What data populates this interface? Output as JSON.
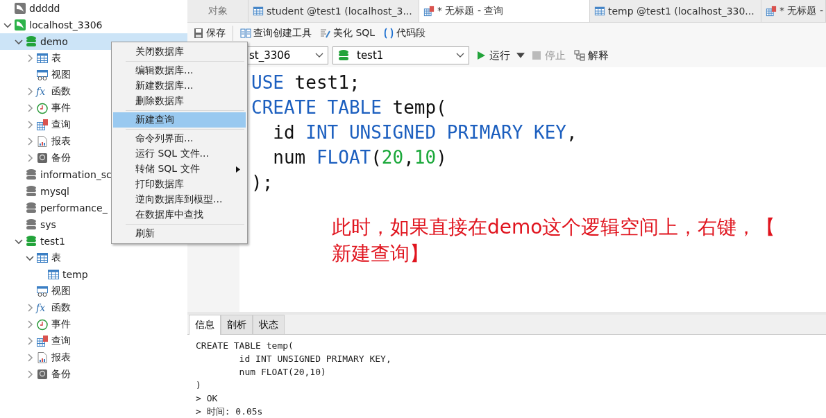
{
  "tree": [
    {
      "label": "ddddd",
      "kind": "server-gray",
      "selected": false
    },
    {
      "label": "localhost_3306",
      "kind": "server",
      "selected": false,
      "expanded": true,
      "children": [
        {
          "label": "demo",
          "kind": "db-green",
          "selected": true,
          "expanded": true,
          "children": [
            {
              "label": "表",
              "kind": "table",
              "selected": false,
              "expanded": false
            },
            {
              "label": "视图",
              "kind": "view",
              "selected": false
            },
            {
              "label": "函数",
              "kind": "function",
              "glyph": "fx",
              "selected": false,
              "expanded": false
            },
            {
              "label": "事件",
              "kind": "event",
              "selected": false,
              "expanded": false
            },
            {
              "label": "查询",
              "kind": "query",
              "selected": false,
              "expanded": false
            },
            {
              "label": "报表",
              "kind": "report",
              "selected": false,
              "expanded": false
            },
            {
              "label": "备份",
              "kind": "backup",
              "selected": false,
              "expanded": false
            }
          ]
        },
        {
          "label": "information_sc",
          "kind": "db-gray",
          "selected": false
        },
        {
          "label": "mysql",
          "kind": "db-gray",
          "selected": false
        },
        {
          "label": "performance_",
          "kind": "db-gray",
          "selected": false
        },
        {
          "label": "sys",
          "kind": "db-gray",
          "selected": false
        },
        {
          "label": "test1",
          "kind": "db-green",
          "selected": false,
          "expanded": true,
          "children": [
            {
              "label": "表",
              "kind": "table",
              "selected": false,
              "expanded": true,
              "children": [
                {
                  "label": "temp",
                  "kind": "table",
                  "selected": false
                }
              ]
            },
            {
              "label": "视图",
              "kind": "view",
              "selected": false
            },
            {
              "label": "函数",
              "kind": "function",
              "glyph": "fx",
              "selected": false,
              "expanded": false
            },
            {
              "label": "事件",
              "kind": "event",
              "selected": false,
              "expanded": false
            },
            {
              "label": "查询",
              "kind": "query",
              "selected": false,
              "expanded": false
            },
            {
              "label": "报表",
              "kind": "report",
              "selected": false,
              "expanded": false
            },
            {
              "label": "备份",
              "kind": "backup",
              "selected": false,
              "expanded": false
            }
          ]
        }
      ]
    }
  ],
  "tabs": [
    {
      "label": "对象",
      "selected": false
    },
    {
      "label": "student @test1 (localhost_3...",
      "kind": "table",
      "selected": false
    },
    {
      "label": "* 无标题 - 查询",
      "kind": "query",
      "selected": true
    },
    {
      "label": "temp @test1 (localhost_330...",
      "kind": "table",
      "selected": false
    },
    {
      "label": "* 无标题 -",
      "kind": "query",
      "selected": false
    }
  ],
  "toolbar": [
    {
      "label": "保存",
      "kind": "save",
      "separator_after": true
    },
    {
      "label": "查询创建工具",
      "kind": "builder"
    },
    {
      "label": "美化 SQL",
      "kind": "beautify"
    },
    {
      "label": "代码段",
      "kind": "snippet"
    }
  ],
  "connection_select": {
    "value": "st_3306"
  },
  "database_select": {
    "value": "test1"
  },
  "actions": [
    {
      "label": "运行",
      "kind": "play",
      "disabled": false,
      "dropdown": true
    },
    {
      "label": "停止",
      "kind": "stop",
      "disabled": true
    },
    {
      "label": "解释",
      "kind": "explain",
      "disabled": false
    }
  ],
  "editor": {
    "lines": [
      [
        {
          "text": "USE",
          "kind": "keyword"
        },
        {
          "text": " test1;",
          "kind": "plain"
        }
      ],
      [
        {
          "text": "CREATE TABLE",
          "kind": "keyword"
        },
        {
          "text": " temp(",
          "kind": "plain"
        }
      ],
      [
        {
          "text": "  id ",
          "kind": "plain"
        },
        {
          "text": "INT UNSIGNED PRIMARY KEY",
          "kind": "keyword"
        },
        {
          "text": ",",
          "kind": "plain"
        }
      ],
      [
        {
          "text": "  num ",
          "kind": "plain"
        },
        {
          "text": "FLOAT",
          "kind": "keyword"
        },
        {
          "text": "(",
          "kind": "plain"
        },
        {
          "text": "20",
          "kind": "number"
        },
        {
          "text": ",",
          "kind": "plain"
        },
        {
          "text": "10",
          "kind": "number"
        },
        {
          "text": ")",
          "kind": "plain"
        }
      ],
      [
        {
          "text": ");",
          "kind": "plain"
        }
      ]
    ]
  },
  "annotation": "此时，如果直接在demo这个逻辑空间上，右键，【新建查询】",
  "result_tabs": [
    {
      "label": "信息",
      "selected": true
    },
    {
      "label": "剖析",
      "selected": false
    },
    {
      "label": "状态",
      "selected": false
    }
  ],
  "output": [
    "CREATE TABLE temp(",
    "        id INT UNSIGNED PRIMARY KEY,",
    "        num FLOAT(20,10)",
    ")",
    "> OK",
    "> 时间: 0.05s"
  ],
  "context_menu": {
    "groups": [
      [
        {
          "label": "关闭数据库",
          "selected": false
        }
      ],
      [
        {
          "label": "编辑数据库...",
          "selected": false
        },
        {
          "label": "新建数据库...",
          "selected": false
        },
        {
          "label": "删除数据库",
          "selected": false
        }
      ],
      [
        {
          "label": "新建查询",
          "selected": true
        }
      ],
      [
        {
          "label": "命令列界面...",
          "selected": false
        },
        {
          "label": "运行 SQL 文件...",
          "selected": false
        },
        {
          "label": "转储 SQL 文件",
          "selected": false,
          "submenu": true
        },
        {
          "label": "打印数据库",
          "selected": false
        },
        {
          "label": "逆向数据库到模型...",
          "selected": false
        },
        {
          "label": "在数据库中查找",
          "selected": false
        }
      ],
      [
        {
          "label": "刷新",
          "selected": false
        }
      ]
    ]
  }
}
